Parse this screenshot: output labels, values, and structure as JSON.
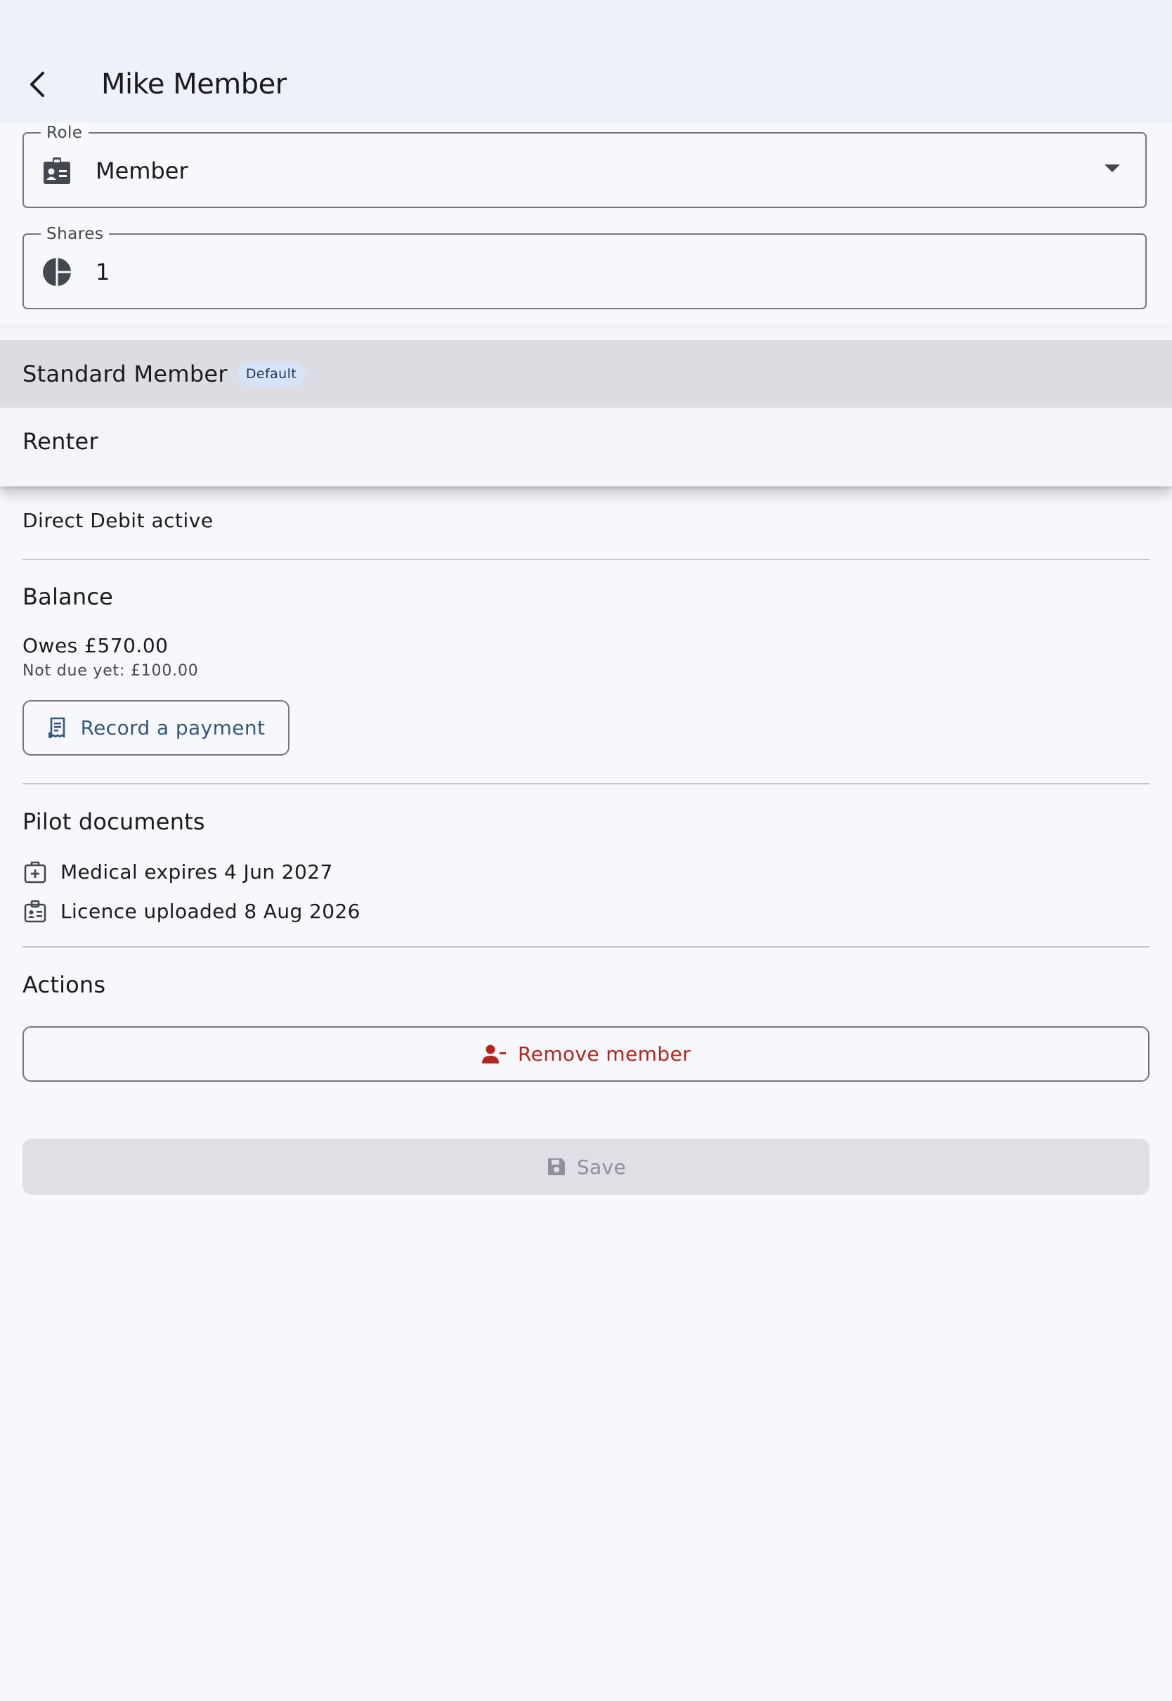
{
  "header": {
    "title": "Mike Member"
  },
  "role_field": {
    "legend": "Role",
    "value": "Member"
  },
  "shares_field": {
    "legend": "Shares",
    "value": "1"
  },
  "dropdown_menu": {
    "items": [
      {
        "label": "Standard Member",
        "badge": "Default",
        "selected": true
      },
      {
        "label": "Renter",
        "selected": false
      }
    ]
  },
  "payment": {
    "status": "Direct Debit active"
  },
  "balance": {
    "heading": "Balance",
    "owes": "Owes £570.00",
    "not_due": "Not due yet: £100.00",
    "record_button": "Record a payment"
  },
  "pilot_documents": {
    "heading": "Pilot documents",
    "items": [
      {
        "text": "Medical expires 4 Jun 2027",
        "icon": "medical-bag-icon"
      },
      {
        "text": "Licence uploaded 8 Aug 2026",
        "icon": "licence-badge-icon"
      }
    ]
  },
  "actions": {
    "heading": "Actions",
    "remove_button": "Remove member"
  },
  "save_button": {
    "label": "Save",
    "enabled": false
  },
  "colors": {
    "accent": "#33577d",
    "danger": "#b3261e",
    "disabled_bg": "#dfe0e5",
    "menu_selected": "#dcdde2"
  }
}
